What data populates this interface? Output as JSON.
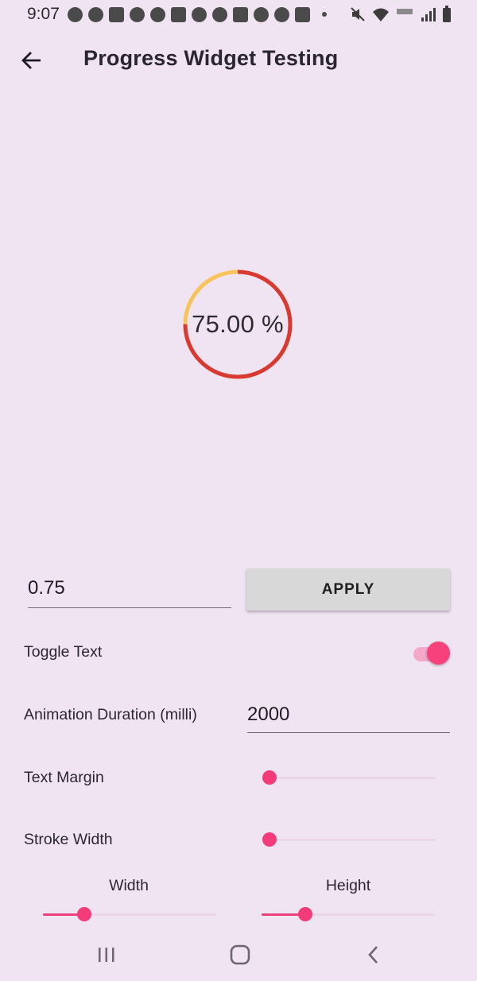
{
  "status_bar": {
    "time": "9:07"
  },
  "app_bar": {
    "title": "Progress Widget Testing",
    "back_icon": "arrow-back-icon"
  },
  "progress": {
    "label": "75.00 %",
    "value": 0.75,
    "progress_color": "#d83a33",
    "remaining_color": "#f6c45b"
  },
  "controls": {
    "value_input": "0.75",
    "apply_label": "APPLY",
    "toggle_text_label": "Toggle Text",
    "toggle_text_on": true,
    "animation_duration_label": "Animation Duration (milli)",
    "animation_duration_value": "2000",
    "text_margin_label": "Text Margin",
    "text_margin_value": 0.04,
    "stroke_width_label": "Stroke Width",
    "stroke_width_value": 0.04,
    "width_label": "Width",
    "width_value": 0.24,
    "height_label": "Height",
    "height_value": 0.25
  },
  "colors": {
    "background": "#f1e4f2",
    "accent": "#f23b78"
  },
  "nav_bar": {
    "recents_icon": "recents-icon",
    "home_icon": "home-icon",
    "back_icon": "nav-back-icon"
  }
}
